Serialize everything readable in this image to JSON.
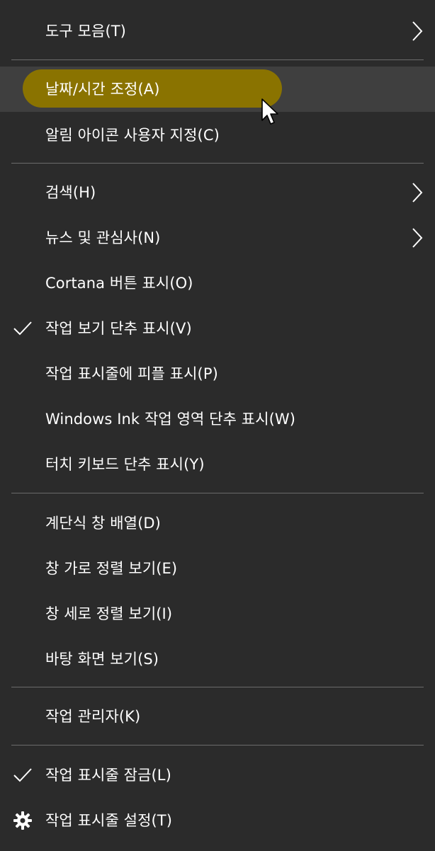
{
  "menu": {
    "items": [
      {
        "label": "도구 모음(T)",
        "submenu": true
      },
      {
        "label": "날짜/시간 조정(A)",
        "highlighted": true
      },
      {
        "label": "알림 아이콘 사용자 지정(C)"
      },
      {
        "label": "검색(H)",
        "submenu": true
      },
      {
        "label": "뉴스 및 관심사(N)",
        "submenu": true
      },
      {
        "label": "Cortana 버튼 표시(O)"
      },
      {
        "label": "작업 보기 단추 표시(V)",
        "checked": true
      },
      {
        "label": "작업 표시줄에 피플 표시(P)"
      },
      {
        "label": "Windows Ink 작업 영역 단추 표시(W)"
      },
      {
        "label": "터치 키보드 단추 표시(Y)"
      },
      {
        "label": "계단식 창 배열(D)"
      },
      {
        "label": "창 가로 정렬 보기(E)"
      },
      {
        "label": "창 세로 정렬 보기(I)"
      },
      {
        "label": "바탕 화면 보기(S)"
      },
      {
        "label": "작업 관리자(K)"
      },
      {
        "label": "작업 표시줄 잠금(L)",
        "checked": true
      },
      {
        "label": "작업 표시줄 설정(T)",
        "icon": "gear-icon"
      }
    ]
  },
  "colors": {
    "background": "#2b2b2b",
    "hover_band": "#3f3f3f",
    "highlight": "#8a7300",
    "separator": "#6b6b6b",
    "text": "#ffffff"
  }
}
